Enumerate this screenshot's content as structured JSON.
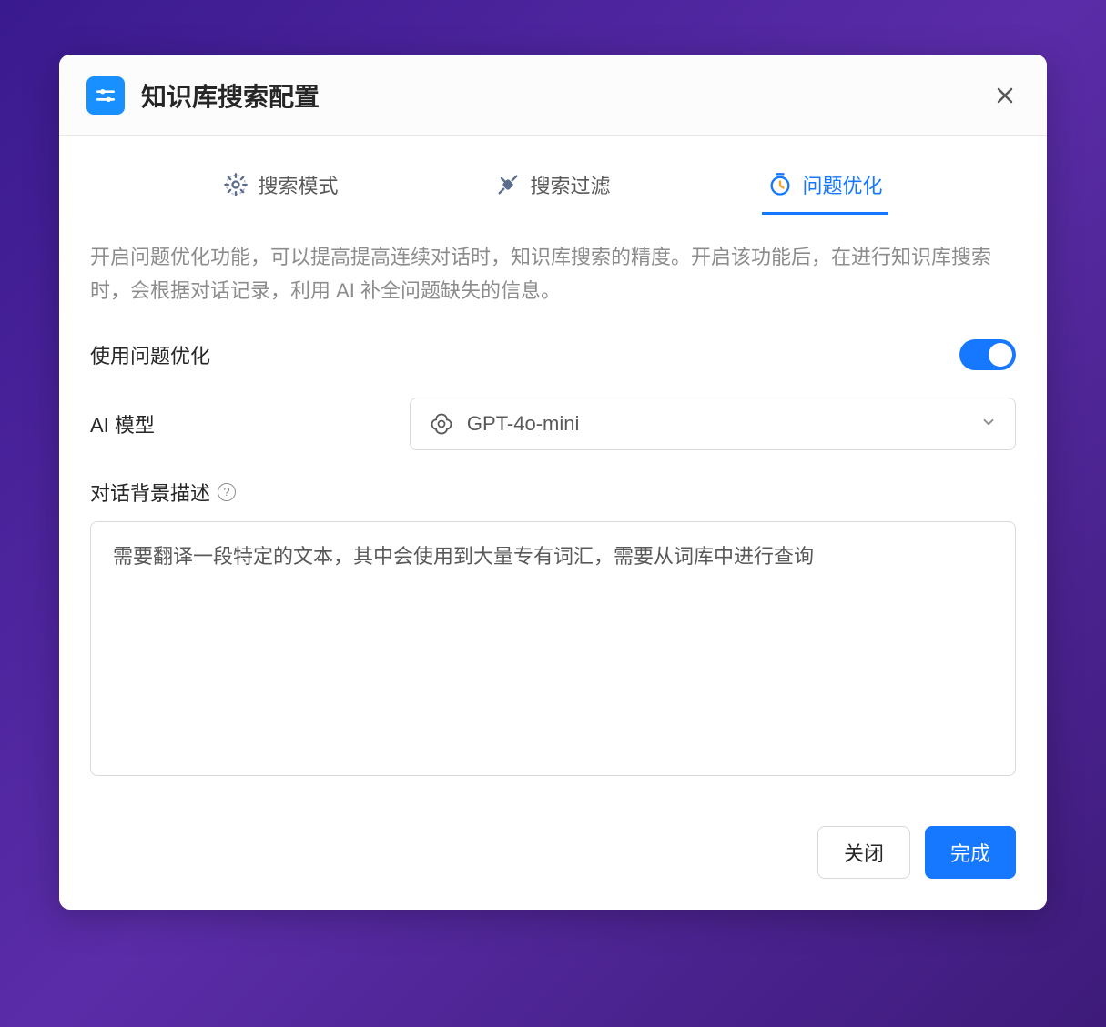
{
  "modal": {
    "title": "知识库搜索配置"
  },
  "tabs": {
    "search_mode": "搜索模式",
    "search_filter": "搜索过滤",
    "question_optimize": "问题优化"
  },
  "content": {
    "description": "开启问题优化功能，可以提高提高连续对话时，知识库搜索的精度。开启该功能后，在进行知识库搜索时，会根据对话记录，利用 AI 补全问题缺失的信息。",
    "toggle_label": "使用问题优化",
    "toggle_enabled": true,
    "model_label": "AI 模型",
    "model_selected": "GPT-4o-mini",
    "context_label": "对话背景描述",
    "context_value": "需要翻译一段特定的文本，其中会使用到大量专有词汇，需要从词库中进行查询"
  },
  "footer": {
    "cancel": "关闭",
    "confirm": "完成"
  }
}
